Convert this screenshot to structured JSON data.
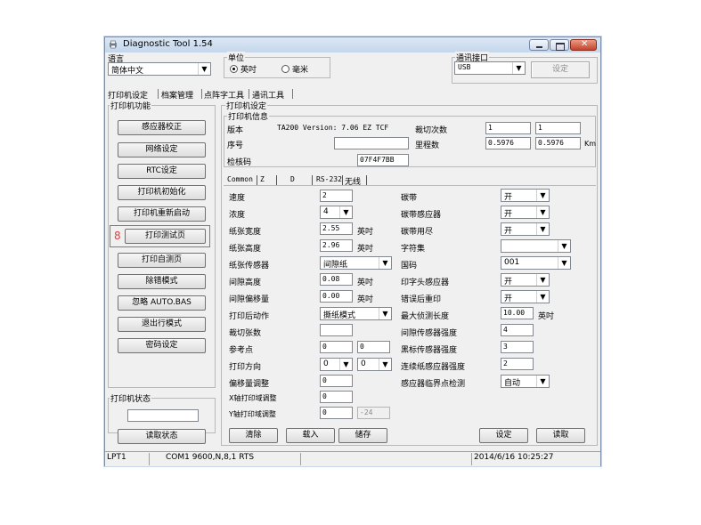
{
  "window": {
    "title": "Diagnostic Tool 1.54"
  },
  "language": {
    "group_label": "语言",
    "selected": "简体中文"
  },
  "unit": {
    "group_label": "单位",
    "options": [
      "英吋",
      "毫米"
    ],
    "selected": "英吋"
  },
  "comm": {
    "group_label": "通讯接口",
    "selected": "USB",
    "set_button": "设定"
  },
  "main_tabs": [
    "打印机设定",
    "档案管理",
    "点阵字工具",
    "通讯工具"
  ],
  "printer_functions": {
    "group_label": "打印机功能",
    "buttons": [
      "感应器校正",
      "网络设定",
      "RTC设定",
      "打印机初始化",
      "打印机重新启动",
      "打印测试页",
      "打印自测页",
      "除错模式",
      "忽略 AUTO.BAS",
      "退出行模式",
      "密码设定"
    ],
    "highlight_index": 5,
    "highlight_number": "8"
  },
  "printer_status": {
    "group_label": "打印机状态",
    "read_button": "读取状态",
    "value": ""
  },
  "printer_settings": {
    "group_label": "打印机设定",
    "info": {
      "group_label": "打印机信息",
      "version_label": "版本",
      "version_value": "TA200 Version: 7.06 EZ TCF",
      "serial_label": "序号",
      "serial_value": "",
      "checksum_label": "检核码",
      "checksum_value": "07F4F7BB",
      "cut_label": "裁切次数",
      "cut_value1": "1",
      "cut_value2": "1",
      "mileage_label": "里程数",
      "mileage_value1": "0.5976",
      "mileage_value2": "0.5976",
      "mileage_unit": "Km"
    },
    "sub_tabs": [
      "Common",
      "Z",
      "D",
      "RS-232",
      "无线"
    ],
    "left": {
      "speed_label": "速度",
      "speed_value": "2",
      "density_label": "浓度",
      "density_value": "4",
      "width_label": "纸张宽度",
      "width_value": "2.55",
      "width_unit": "英吋",
      "height_label": "纸张高度",
      "height_value": "2.96",
      "height_unit": "英吋",
      "sensor_label": "纸张传感器",
      "sensor_value": "间隙纸",
      "gap_label": "间隙高度",
      "gap_value": "0.08",
      "gap_unit": "英吋",
      "gap_offset_label": "间隙偏移量",
      "gap_offset_value": "0.00",
      "gap_offset_unit": "英吋",
      "post_action_label": "打印后动作",
      "post_action_value": "撕纸模式",
      "cut_count_label": "裁切张数",
      "cut_count_value": "",
      "ref_label": "参考点",
      "ref_x": "0",
      "ref_y": "0",
      "direction_label": "打印方向",
      "direction_a": "0",
      "direction_b": "0",
      "shift_label": "偏移量调整",
      "shift_value": "0",
      "x_adj_label": "X轴打印域调整",
      "x_adj_value": "0",
      "y_adj_label": "Y轴打印域调整",
      "y_adj_value": "0",
      "y_adj_value2": "-24"
    },
    "right": {
      "ribbon_label": "碳带",
      "ribbon_value": "开",
      "ribbon_sensor_label": "碳带感应器",
      "ribbon_sensor_value": "开",
      "ribbon_end_label": "碳带用尽",
      "ribbon_end_value": "开",
      "charset_label": "字符集",
      "charset_value": "",
      "codepage_label": "国码",
      "codepage_value": "001",
      "head_sensor_label": "印字头感应器",
      "head_sensor_value": "开",
      "reprint_label": "错误后重印",
      "reprint_value": "开",
      "max_len_label": "最大侦测长度",
      "max_len_value": "10.00",
      "max_len_unit": "英吋",
      "gap_intensity_label": "间隙传感器强度",
      "gap_intensity_value": "4",
      "bline_intensity_label": "黑标传感器强度",
      "bline_intensity_value": "3",
      "cont_intensity_label": "连续纸感应器强度",
      "cont_intensity_value": "2",
      "threshold_label": "感应器临界点检测",
      "threshold_value": "自动"
    },
    "bottom_buttons": {
      "clear": "清除",
      "load": "载入",
      "save": "储存",
      "set": "设定",
      "read": "读取"
    }
  },
  "statusbar": {
    "port": "LPT1",
    "serial": "COM1 9600,N,8,1 RTS",
    "middle": "",
    "datetime": "2014/6/16 10:25:27"
  }
}
